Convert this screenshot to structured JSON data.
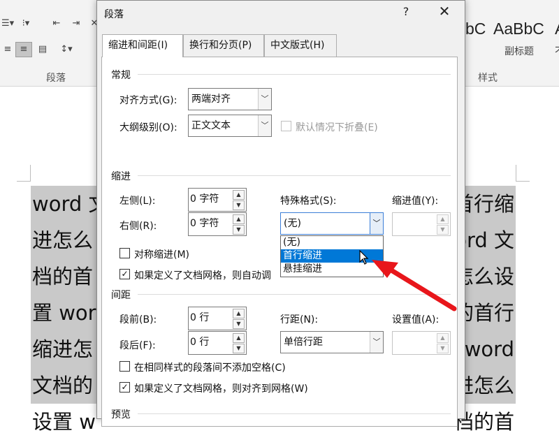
{
  "ribbon": {
    "paragraph_group_label": "段落",
    "styles_group_label": "样式",
    "style_samples": [
      "AaBbC",
      "AaBbC"
    ],
    "style_sample_left_partial": "bC",
    "style_names": [
      "副标题"
    ],
    "style_name_right_partial": "不"
  },
  "document": {
    "lines": [
      [
        "word 文",
        "首行缩"
      ],
      [
        "进怎么",
        "word 文"
      ],
      [
        "档的首",
        "怎么设"
      ],
      [
        "置 wor",
        "的首行"
      ],
      [
        "缩进怎",
        "word"
      ],
      [
        "文档的",
        "进怎么"
      ],
      [
        "设置 w",
        "档的首"
      ]
    ]
  },
  "dialog": {
    "title": "段落",
    "help_label": "?",
    "close_label": "✕",
    "tabs": [
      {
        "label": "缩进和间距(I)",
        "active": true
      },
      {
        "label": "换行和分页(P)",
        "active": false
      },
      {
        "label": "中文版式(H)",
        "active": false
      }
    ],
    "general": {
      "title": "常规",
      "alignment_label": "对齐方式(G):",
      "alignment_value": "两端对齐",
      "outline_label": "大纲级别(O):",
      "outline_value": "正文文本",
      "collapse_label": "默认情况下折叠(E)"
    },
    "indent": {
      "title": "缩进",
      "left_label": "左侧(L):",
      "left_value": "0 字符",
      "right_label": "右侧(R):",
      "right_value": "0 字符",
      "special_label": "特殊格式(S):",
      "special_value": "(无)",
      "special_options": [
        "(无)",
        "首行缩进",
        "悬挂缩进"
      ],
      "special_highlighted": "首行缩进",
      "by_label": "缩进值(Y):",
      "by_value": "",
      "mirror_label": "对称缩进(M)",
      "mirror_checked": false,
      "auto_adjust_label": "如果定义了文档网格，则自动调",
      "auto_adjust_checked": true
    },
    "spacing": {
      "title": "间距",
      "before_label": "段前(B):",
      "before_value": "0 行",
      "after_label": "段后(F):",
      "after_value": "0 行",
      "line_spacing_label": "行距(N):",
      "line_spacing_value": "单倍行距",
      "at_label": "设置值(A):",
      "at_value": "",
      "no_space_label": "在相同样式的段落间不添加空格(C)",
      "no_space_checked": false,
      "snap_grid_label": "如果定义了文档网格，则对齐到网格(W)",
      "snap_grid_checked": true
    },
    "preview": {
      "title": "预览"
    }
  },
  "colors": {
    "accent": "#0078d7",
    "annotation_arrow": "#e8161b",
    "selection_highlight": "#c9c9c9"
  }
}
